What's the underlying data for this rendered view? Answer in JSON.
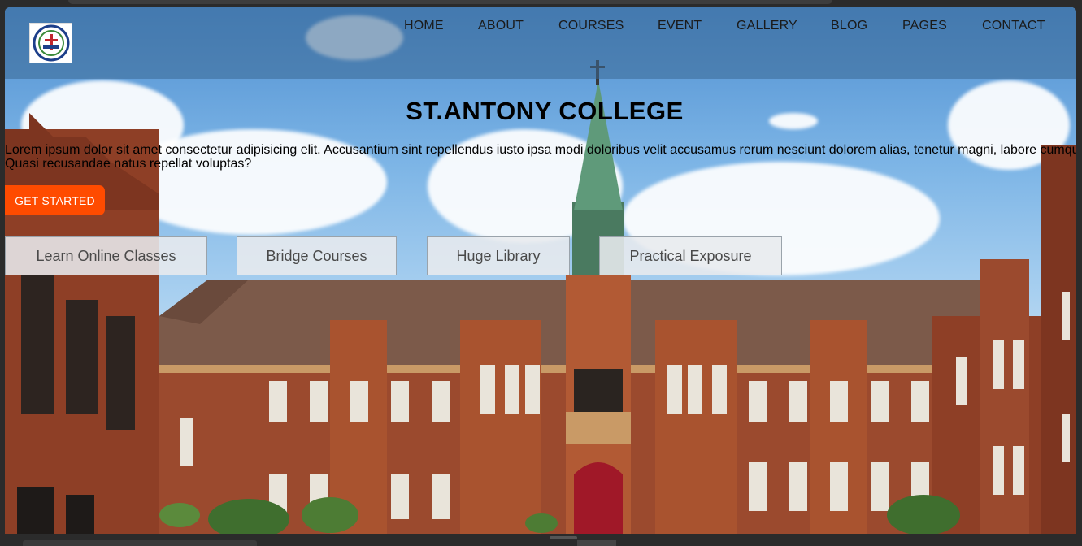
{
  "header": {
    "logo_label": "ST. ANTONY COLLEGE",
    "nav": [
      {
        "label": "HOME"
      },
      {
        "label": "ABOUT"
      },
      {
        "label": "COURSES"
      },
      {
        "label": "EVENT"
      },
      {
        "label": "GALLERY"
      },
      {
        "label": "BLOG"
      },
      {
        "label": "PAGES"
      },
      {
        "label": "CONTACT"
      }
    ]
  },
  "hero": {
    "title": "ST.ANTONY COLLEGE",
    "text_line1": "Lorem ipsum dolor sit amet consectetur adipisicing elit. Accusantium sint repellendus iusto ipsa modi doloribus velit accusamus rerum nesciunt dolorem alias, tenetur magni, labore cumque,",
    "text_line2": "Quasi recusandae natus repellat voluptas?",
    "cta_label": "GET STARTED"
  },
  "features": [
    {
      "label": "Learn Online Classes"
    },
    {
      "label": "Bridge Courses"
    },
    {
      "label": "Huge Library"
    },
    {
      "label": "Practical Exposure"
    }
  ],
  "colors": {
    "cta": "#ff4b00",
    "header_overlay": "#3a6894",
    "brick": "#9b4a2e",
    "roof": "#7a5a4a",
    "spire": "#4f8a6a",
    "door": "#a01828"
  },
  "icons": {
    "logo": "college-crest-icon"
  }
}
